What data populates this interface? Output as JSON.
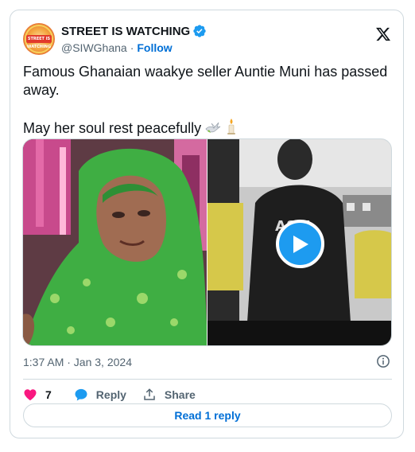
{
  "author": {
    "display_name": "STREET IS WATCHING",
    "handle": "@SIWGhana",
    "separator": "·",
    "follow_label": "Follow",
    "avatar_text": "STREET IS WATCHING",
    "verified_icon": "verified-badge-icon"
  },
  "tweet": {
    "line1": "Famous Ghanaian waakye seller Auntie Muni has passed away.",
    "line2": "May her soul rest peacefully",
    "emojis": [
      "dove",
      "candle"
    ],
    "timestamp": "1:37 AM · Jan 3, 2024"
  },
  "media": {
    "left_image": "woman-in-green-hijab",
    "right_image": "video-still-men-outdoors",
    "play_icon": "play-icon"
  },
  "actions": {
    "like_count": "7",
    "reply_label": "Reply",
    "share_label": "Share",
    "read_reply_label": "Read 1 reply"
  },
  "colors": {
    "accent": "#1d9bf0",
    "link": "#006fd6",
    "like": "#f91880",
    "border": "#cfd9de",
    "muted": "#536471"
  }
}
